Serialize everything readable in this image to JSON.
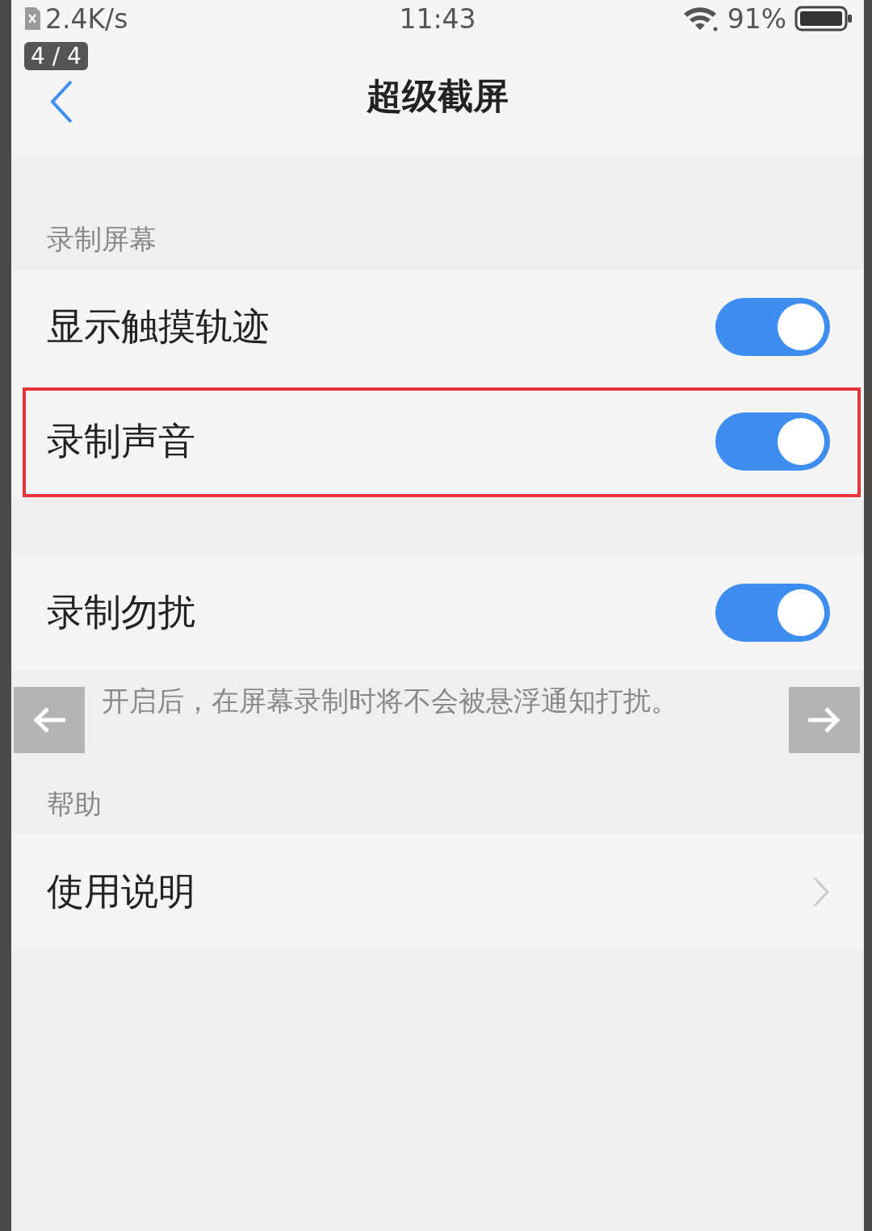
{
  "viewer": {
    "counter": "4 / 4"
  },
  "status_bar": {
    "network_speed": "2.4K/s",
    "time": "11:43",
    "battery": "91%"
  },
  "nav": {
    "title": "超级截屏"
  },
  "sections": [
    {
      "header": "录制屏幕",
      "rows": [
        {
          "kind": "toggle",
          "label": "显示触摸轨迹",
          "on": true,
          "highlighted": false
        },
        {
          "kind": "toggle",
          "label": "录制声音",
          "on": true,
          "highlighted": true
        }
      ]
    },
    {
      "rows": [
        {
          "kind": "toggle",
          "label": "录制勿扰",
          "on": true,
          "highlighted": false
        }
      ],
      "note": "开启后，在屏幕录制时将不会被悬浮通知打扰。"
    },
    {
      "header": "帮助",
      "rows": [
        {
          "kind": "link",
          "label": "使用说明",
          "highlighted": false
        }
      ]
    }
  ]
}
